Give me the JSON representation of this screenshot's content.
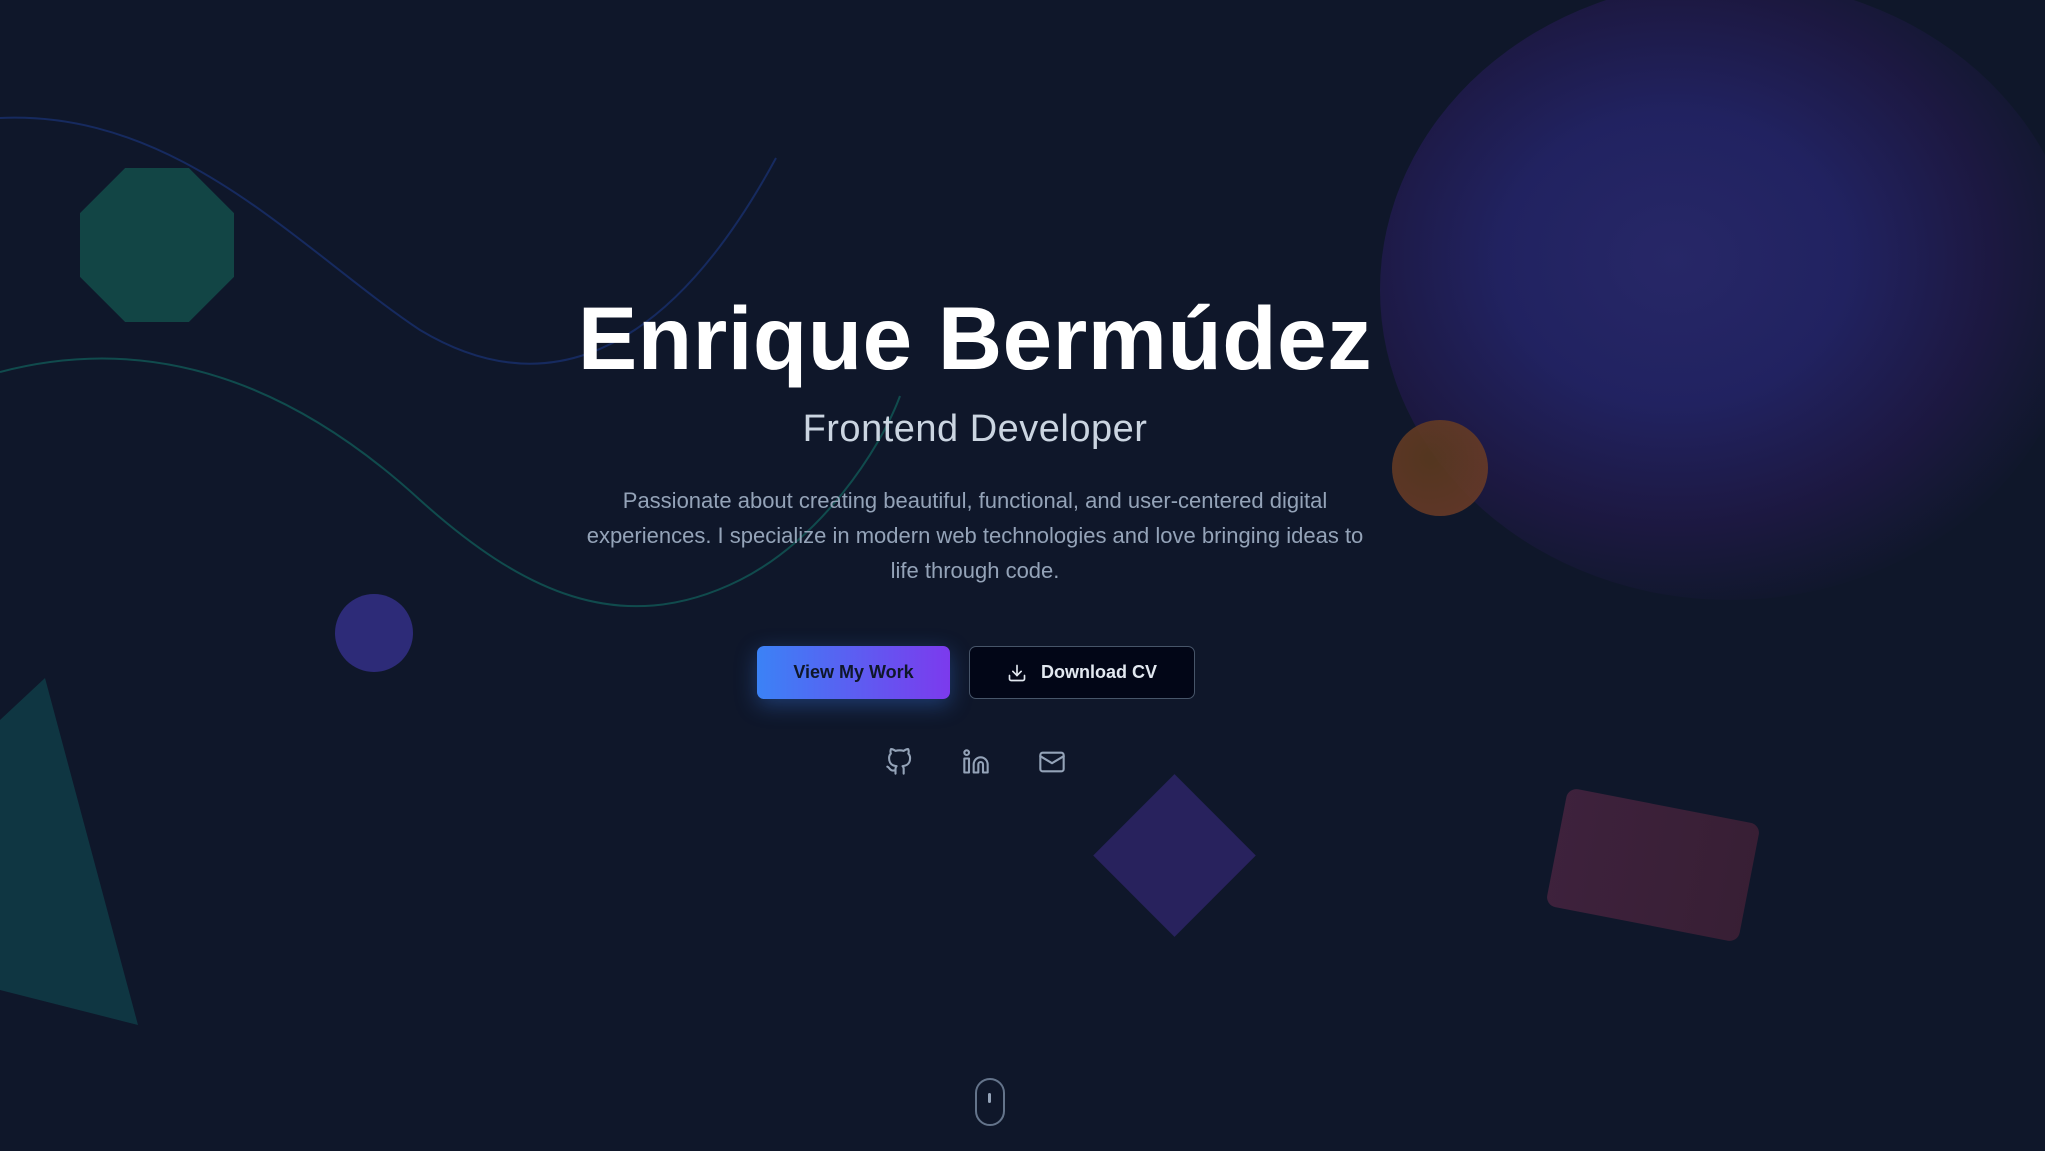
{
  "hero": {
    "name": "Enrique Bermúdez",
    "role": "Frontend Developer",
    "description": "Passionate about creating beautiful, functional, and user-centered digital experiences. I specialize in modern web technologies and love bringing ideas to life through code."
  },
  "actions": {
    "primary_label": "View My Work",
    "secondary_label": "Download CV",
    "secondary_icon": "download-icon"
  },
  "social": [
    {
      "icon": "github-icon"
    },
    {
      "icon": "linkedin-icon"
    },
    {
      "icon": "mail-icon"
    }
  ],
  "scroll_indicator": {
    "icon": "mouse-scroll-icon"
  },
  "colors": {
    "background": "#0f172a",
    "accent_start": "#3b82f6",
    "accent_end": "#7c3aed",
    "heading": "#ffffff",
    "subtitle": "#cbd5e1",
    "body_text": "#94a3b8"
  }
}
